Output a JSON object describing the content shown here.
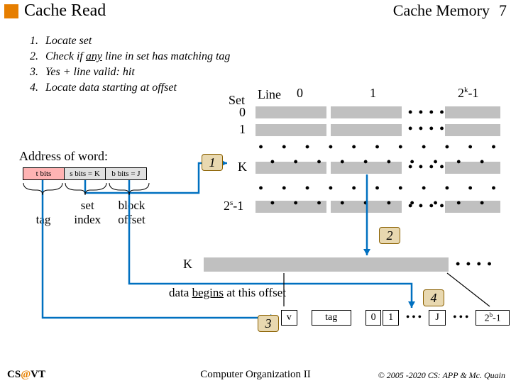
{
  "header": {
    "title": "Cache Read",
    "section": "Cache Memory",
    "slide_num": "7"
  },
  "steps": {
    "n1": "1.",
    "s1": "Locate set",
    "n2": "2.",
    "s2a": "Check if ",
    "s2u": "any",
    "s2b": " line in set has matching tag",
    "n3": "3.",
    "s3": "Yes + line valid: hit",
    "n4": "4.",
    "s4": "Locate data starting at offset"
  },
  "address": {
    "label": "Address of word:",
    "t": "t bits",
    "s": "s bits = K",
    "b": "b bits = J",
    "tag": "tag",
    "set1": "set",
    "set2": "index",
    "block1": "block",
    "block2": "offset"
  },
  "grid": {
    "line": "Line",
    "set": "Set",
    "c0": "0",
    "c1": "1",
    "c2k": "2",
    "c2k_exp": "k",
    "c2k_tail": "-1",
    "r0": "0",
    "r1": "1",
    "rK": "K",
    "r2s": "2",
    "r2s_exp": "s",
    "r2s_tail": "-1"
  },
  "bottomK": "K",
  "data_begins": {
    "a": "data ",
    "u": "begins",
    "b": " at this offset"
  },
  "detail": {
    "v": "v",
    "tag": "tag",
    "c0": "0",
    "c1": "1",
    "j": "J",
    "c2b": "2",
    "c2b_exp": "b",
    "c2b_tail": "-1"
  },
  "bubbles": {
    "b1": "1",
    "b2": "2",
    "b3": "3",
    "b4": "4"
  },
  "footer": {
    "left1": "CS",
    "left2": "@",
    "left3": "VT",
    "center": "Computer Organization II",
    "right": "© 2005 -2020 CS: APP & Mc. Quain"
  }
}
